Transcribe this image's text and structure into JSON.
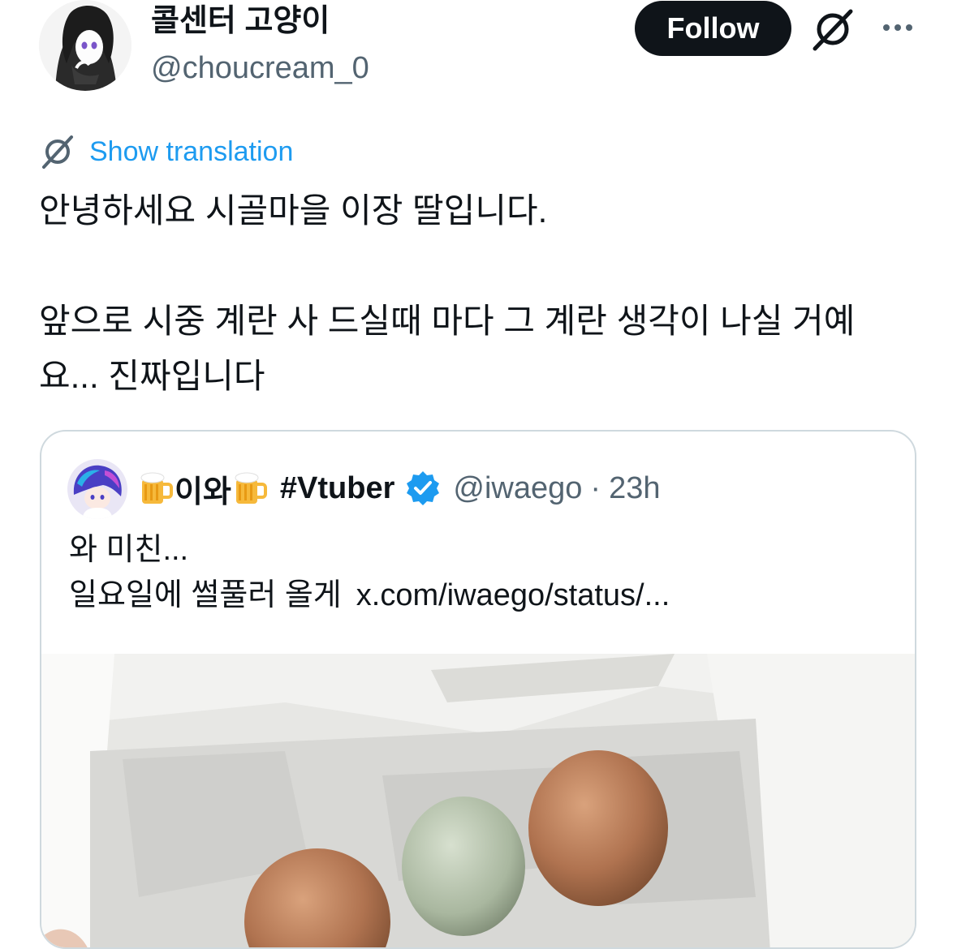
{
  "author": {
    "display_name": "콜센터 고양이",
    "handle": "@choucream_0"
  },
  "actions": {
    "follow_label": "Follow"
  },
  "translation": {
    "label": "Show translation"
  },
  "tweet": {
    "paragraphs": [
      "안녕하세요 시골마을 이장 딸입니다.",
      "앞으로 시중 계란 사 드실때 마다 그 계란 생각이 나실 거예",
      "요... 진짜입니다"
    ]
  },
  "quote": {
    "display_name": "이와",
    "display_hashtag": "#Vtuber",
    "handle": "@iwaego",
    "separator": "·",
    "time": "23h",
    "lines": [
      "와 미친...",
      "일요일에 썰풀러 올게"
    ],
    "link_text": "x.com/iwaego/status/..."
  },
  "icons": {
    "grok": "grok-slash-icon",
    "more": "more-horizontal-icon",
    "verified": "verified-badge-icon",
    "mug": "beer-mug-icon"
  },
  "colors": {
    "text": "#0f1419",
    "secondary": "#536471",
    "link": "#1d9bf0",
    "follow_bg": "#0f1419",
    "border": "#cfd9de"
  }
}
